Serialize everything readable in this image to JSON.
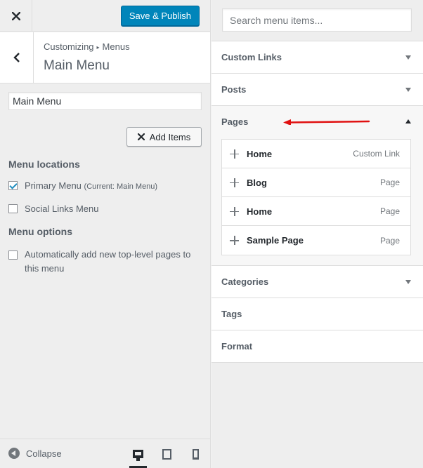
{
  "header": {
    "close_icon": "close-icon",
    "save_publish_label": "Save & Publish"
  },
  "titlebar": {
    "back_icon": "chevron-left-icon",
    "breadcrumb_root": "Customizing",
    "breadcrumb_separator": "▸",
    "breadcrumb_section": "Menus",
    "title": "Main Menu"
  },
  "menu_name": {
    "value": "Main Menu"
  },
  "add_items": {
    "icon": "close-icon",
    "label": "Add Items"
  },
  "menu_locations": {
    "heading": "Menu locations",
    "items": [
      {
        "label": "Primary Menu",
        "note": "(Current: Main Menu)",
        "checked": true
      },
      {
        "label": "Social Links Menu",
        "note": "",
        "checked": false
      }
    ]
  },
  "menu_options": {
    "heading": "Menu options",
    "auto_add_line1": "Automatically add new top-level pages to",
    "auto_add_line2": "this menu",
    "auto_add_checked": false
  },
  "footer": {
    "collapse_label": "Collapse",
    "devices": [
      "desktop",
      "tablet",
      "mobile"
    ],
    "active_device": "desktop"
  },
  "search": {
    "placeholder": "Search menu items..."
  },
  "sections": {
    "custom_links": "Custom Links",
    "posts": "Posts",
    "pages": "Pages",
    "categories": "Categories",
    "tags": "Tags",
    "format": "Format"
  },
  "pages_items": [
    {
      "title": "Home",
      "type": "Custom Link"
    },
    {
      "title": "Blog",
      "type": "Page"
    },
    {
      "title": "Home",
      "type": "Page"
    },
    {
      "title": "Sample Page",
      "type": "Page"
    }
  ],
  "colors": {
    "primary_button": "#0085ba",
    "annotation_arrow": "#e01010"
  }
}
